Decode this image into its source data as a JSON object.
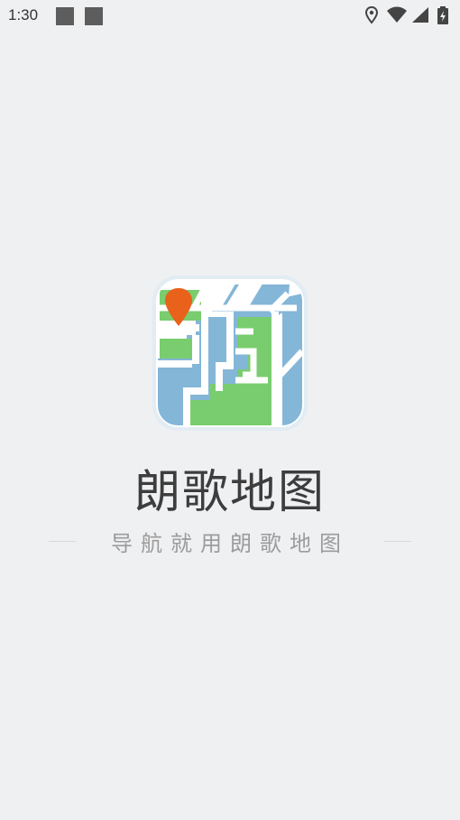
{
  "status_bar": {
    "time": "1:30",
    "icons": [
      "notification-icon",
      "notification-icon",
      "location-icon",
      "wifi-icon",
      "signal-icon",
      "battery-charging-icon"
    ]
  },
  "splash": {
    "app_icon": "map-pin-app-icon",
    "app_name": "朗歌地图",
    "slogan": "导航就用朗歌地图"
  },
  "colors": {
    "background": "#eff0f2",
    "map_blue": "#84b6d8",
    "map_green": "#79cd6e",
    "pin": "#e8621c"
  }
}
